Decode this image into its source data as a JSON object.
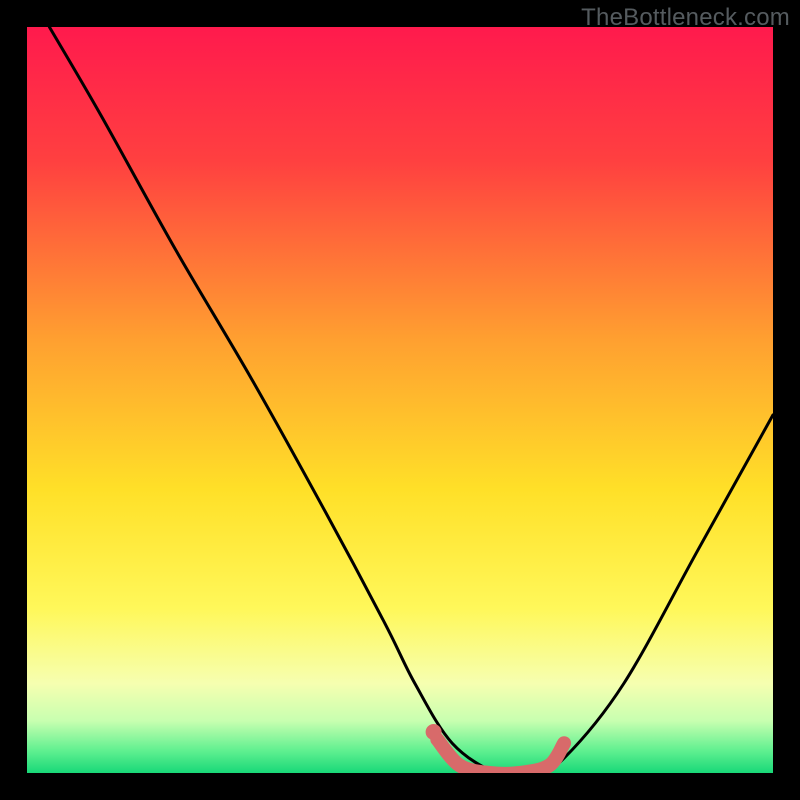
{
  "watermark": "TheBottleneck.com",
  "chart_data": {
    "type": "line",
    "title": "",
    "xlabel": "",
    "ylabel": "",
    "xlim": [
      0,
      100
    ],
    "ylim": [
      0,
      100
    ],
    "series": [
      {
        "name": "curve",
        "x": [
          3,
          10,
          20,
          30,
          40,
          48,
          52,
          57,
          63,
          68,
          72,
          80,
          90,
          100
        ],
        "y": [
          100,
          88,
          70,
          53,
          35,
          20,
          12,
          4,
          0,
          0,
          2,
          12,
          30,
          48
        ]
      }
    ],
    "highlight": {
      "name": "optimal-zone",
      "x": [
        55,
        58,
        62,
        66,
        70,
        72
      ],
      "y": [
        4.5,
        1,
        0,
        0,
        1,
        4
      ]
    },
    "highlight_dot": {
      "x": 54.5,
      "y": 5.5
    },
    "gradient_stops": [
      {
        "offset": 0.0,
        "color": "#ff1a4d"
      },
      {
        "offset": 0.18,
        "color": "#ff4040"
      },
      {
        "offset": 0.42,
        "color": "#ffa030"
      },
      {
        "offset": 0.62,
        "color": "#ffe028"
      },
      {
        "offset": 0.78,
        "color": "#fff85a"
      },
      {
        "offset": 0.88,
        "color": "#f6ffb0"
      },
      {
        "offset": 0.93,
        "color": "#c8ffb0"
      },
      {
        "offset": 0.97,
        "color": "#60f090"
      },
      {
        "offset": 1.0,
        "color": "#18d878"
      }
    ],
    "colors": {
      "curve": "#000000",
      "highlight": "#d86a6a",
      "background_frame": "#000000"
    }
  }
}
